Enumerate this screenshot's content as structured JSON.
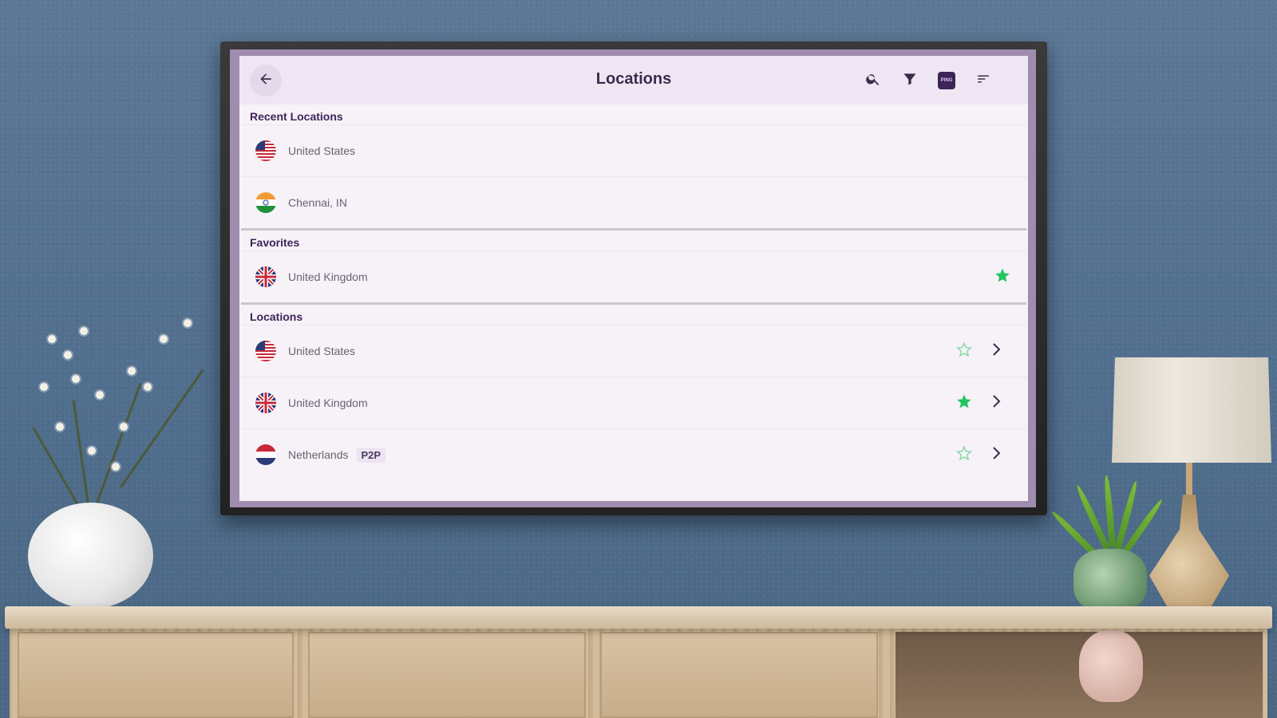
{
  "app": {
    "title": "Locations",
    "ping_badge": "PING"
  },
  "colors": {
    "accent": "#3d2458",
    "star_active": "#22c55e",
    "star_outline": "#86d9a5",
    "appbar_bg": "#efe6f4"
  },
  "icons": {
    "back": "arrow-left-icon",
    "search": "search-icon",
    "filter": "filter-icon",
    "ping": "ping-icon",
    "sort": "sort-icon"
  },
  "sections": {
    "recent": {
      "label": "Recent Locations",
      "items": [
        {
          "name": "United States",
          "flag": "us"
        },
        {
          "name": "Chennai, IN",
          "flag": "in"
        }
      ]
    },
    "favorites": {
      "label": "Favorites",
      "items": [
        {
          "name": "United Kingdom",
          "flag": "uk",
          "favorite": true
        }
      ]
    },
    "locations": {
      "label": "Locations",
      "items": [
        {
          "name": "United States",
          "flag": "us",
          "favorite": false
        },
        {
          "name": "United Kingdom",
          "flag": "uk",
          "favorite": true
        },
        {
          "name": "Netherlands",
          "flag": "nl",
          "favorite": false,
          "tag": "P2P"
        }
      ]
    }
  }
}
